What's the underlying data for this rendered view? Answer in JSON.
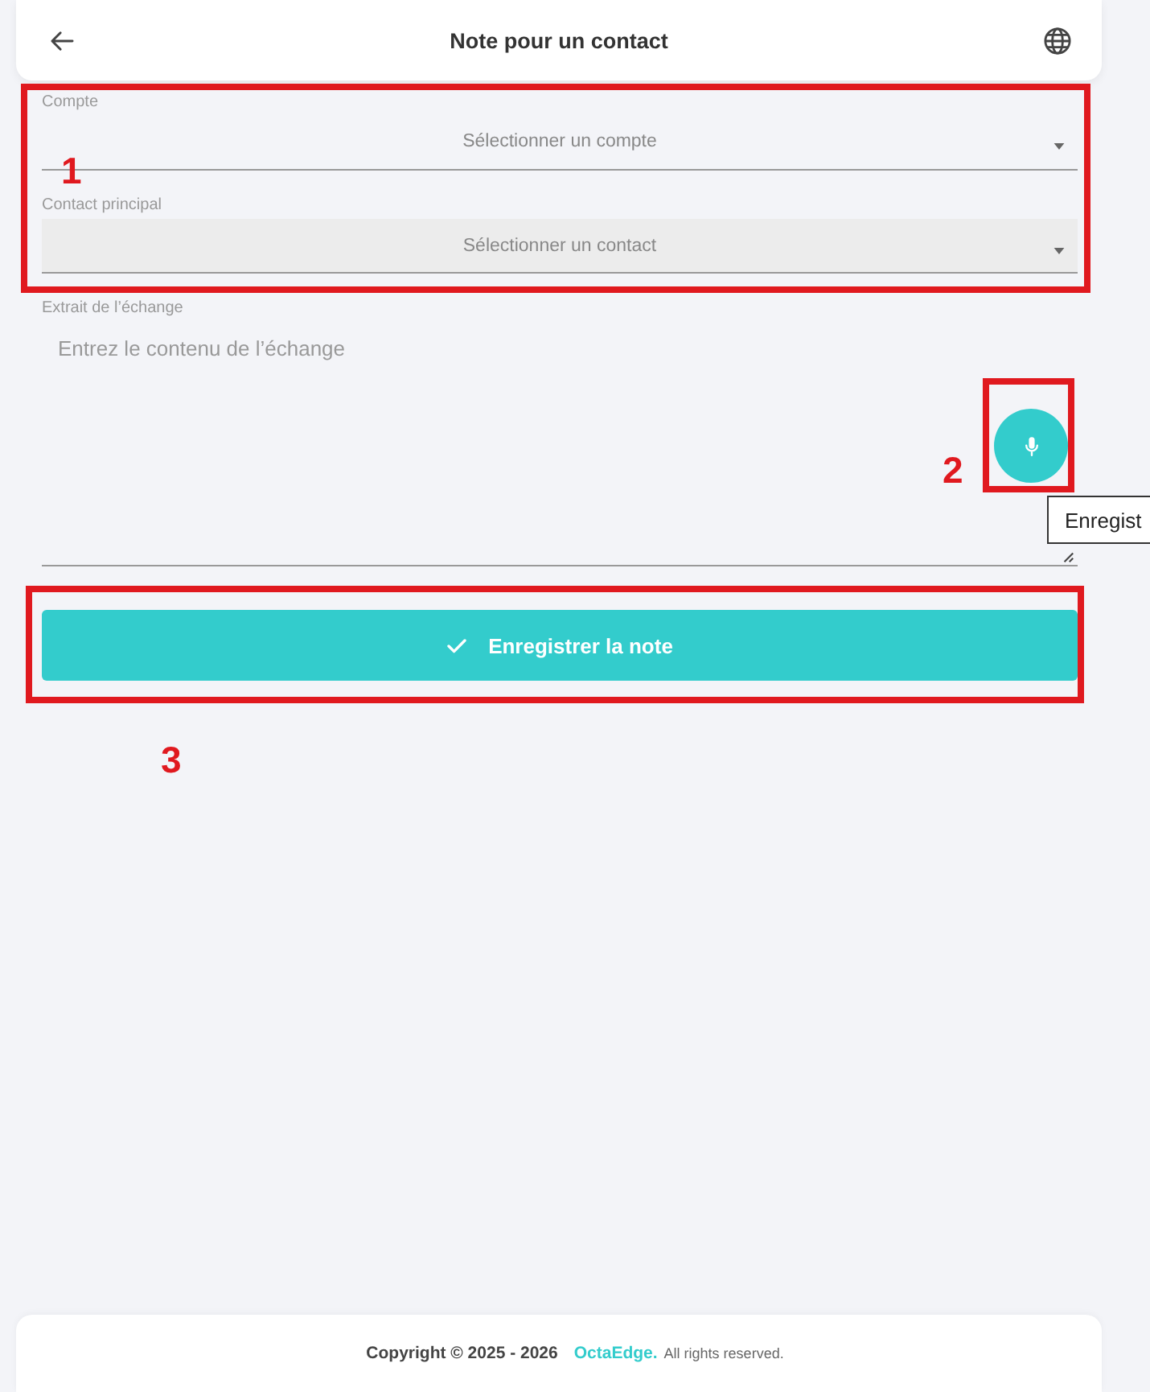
{
  "header": {
    "title": "Note pour un contact"
  },
  "form": {
    "fields": [
      {
        "kind": "select",
        "label": "Compte",
        "placeholder": "Sélectionner un compte",
        "disabled": false
      },
      {
        "kind": "select",
        "label": "Contact principal",
        "placeholder": "Sélectionner un contact",
        "disabled": true
      },
      {
        "kind": "textarea",
        "label": "Extrait de l’échange",
        "placeholder": "Entrez le contenu de l’échange"
      }
    ],
    "mic_button": {
      "tooltip": "Enregist"
    },
    "save_button": {
      "label": "Enregistrer la note"
    }
  },
  "annotations": [
    {
      "number": "1"
    },
    {
      "number": "2"
    },
    {
      "number": "3"
    }
  ],
  "footer": {
    "copyright": "Copyright © 2025 - 2026",
    "brand": "OctaEdge.",
    "rights": "All rights reserved."
  }
}
